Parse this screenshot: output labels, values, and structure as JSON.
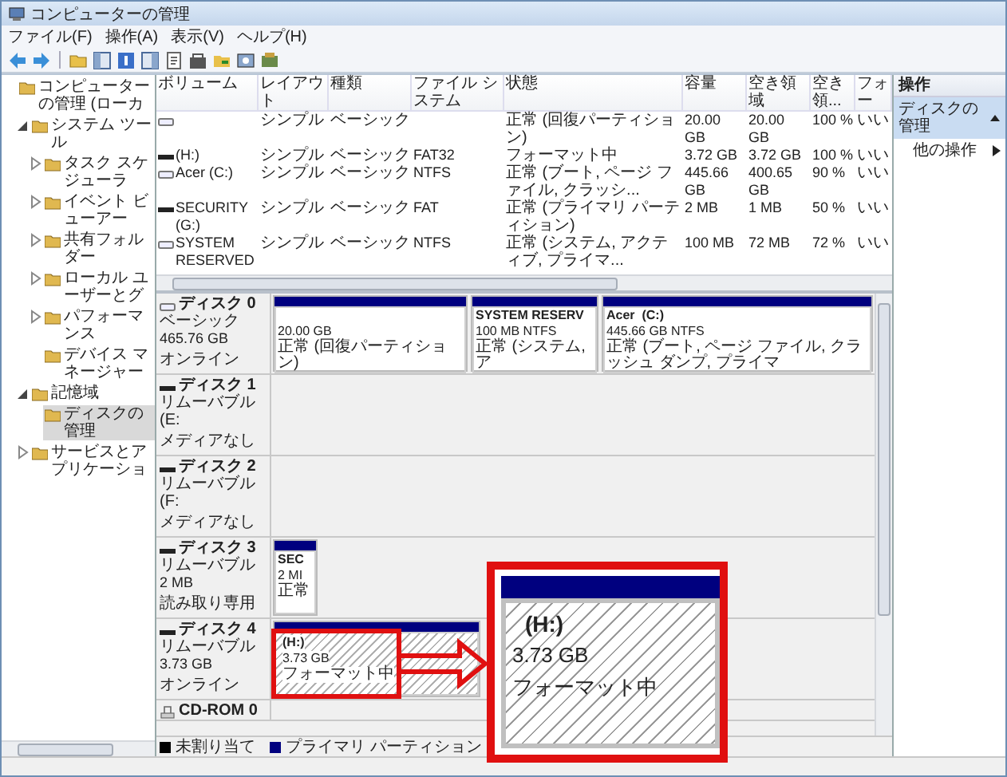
{
  "window": {
    "title": "コンピューターの管理"
  },
  "menu": [
    "ファイル(F)",
    "操作(A)",
    "表示(V)",
    "ヘルプ(H)"
  ],
  "tree": [
    {
      "label": "コンピューターの管理 (ローカ",
      "selected": false,
      "children": [
        {
          "label": "システム ツール",
          "expanded": true,
          "selected": false,
          "children": [
            {
              "label": "タスク スケジューラ",
              "expanded": false,
              "selected": false
            },
            {
              "label": "イベント ビューアー",
              "expanded": false,
              "selected": false
            },
            {
              "label": "共有フォルダー",
              "expanded": false,
              "selected": false
            },
            {
              "label": "ローカル ユーザーとグ",
              "expanded": false,
              "selected": false
            },
            {
              "label": "パフォーマンス",
              "expanded": false,
              "selected": false
            },
            {
              "label": "デバイス マネージャー",
              "selected": false
            }
          ]
        },
        {
          "label": "記憶域",
          "expanded": true,
          "selected": false,
          "children": [
            {
              "label": "ディスクの管理",
              "selected": true
            }
          ]
        },
        {
          "label": "サービスとアプリケーショ",
          "expanded": false,
          "selected": false
        }
      ]
    }
  ],
  "volumes": {
    "columns": [
      "ボリューム",
      "レイアウト",
      "種類",
      "ファイル システム",
      "状態",
      "容量",
      "空き領域",
      "空き領...",
      "フォー"
    ],
    "rows": [
      {
        "kind": "fixed",
        "layout": "シンプル",
        "type": "ベーシック",
        "status": "正常 (回復パーティション)",
        "capacity": "20.00 GB",
        "free_space": "20.00 GB",
        "percent_free": "100 %",
        "column_9": "いい"
      },
      {
        "kind": "removable",
        "volume": "(H:)",
        "layout": "シンプル",
        "type": "ベーシック",
        "file_system": "FAT32",
        "status": "フォーマット中",
        "capacity": "3.72 GB",
        "free_space": "3.72 GB",
        "percent_free": "100 %",
        "column_9": "いい"
      },
      {
        "kind": "fixed",
        "volume": "Acer (C:)",
        "layout": "シンプル",
        "type": "ベーシック",
        "file_system": "NTFS",
        "status": "正常 (ブート, ページ ファイル, クラッシ...",
        "capacity": "445.66 GB",
        "free_space": "400.65 GB",
        "percent_free": "90 %",
        "column_9": "いい"
      },
      {
        "kind": "removable",
        "volume": "SECURITY (G:)",
        "layout": "シンプル",
        "type": "ベーシック",
        "file_system": "FAT",
        "status": "正常 (プライマリ パーティション)",
        "capacity": "2 MB",
        "free_space": "1 MB",
        "percent_free": "50 %",
        "column_9": "いい"
      },
      {
        "kind": "fixed",
        "volume": "SYSTEM RESERVED",
        "layout": "シンプル",
        "type": "ベーシック",
        "file_system": "NTFS",
        "status": "正常 (システム, アクティブ, プライマ...",
        "capacity": "100 MB",
        "free_space": "72 MB",
        "percent_free": "72 %",
        "column_9": "いい"
      }
    ]
  },
  "disks": [
    {
      "kind": "basic",
      "name": "ディスク 0",
      "type": "ベーシック",
      "size": "465.76 GB",
      "status": "オンライン",
      "partitions": [
        {
          "kind": "primary",
          "size": "20.00 GB",
          "status": "正常 (回復パーティション)"
        },
        {
          "kind": "primary",
          "name": "SYSTEM RESERV",
          "size": "100 MB NTFS",
          "status": "正常 (システム, ア"
        },
        {
          "kind": "primary",
          "name": "Acer  (C:)",
          "size": "445.66 GB NTFS",
          "status": "正常 (ブート, ページ ファイル, クラッシュ ダンプ, プライマ"
        }
      ]
    },
    {
      "kind": "removable",
      "name": "ディスク 1",
      "type": "リムーバブル (E:",
      "status": "メディアなし"
    },
    {
      "kind": "removable",
      "name": "ディスク 2",
      "type": "リムーバブル (F:",
      "status": "メディアなし"
    },
    {
      "kind": "removable",
      "name": "ディスク 3",
      "type": "リムーバブル",
      "size": "2 MB",
      "status": "読み取り専用",
      "partitions": [
        {
          "kind": "primary",
          "name": "SEC",
          "size": "2 MI",
          "status": "正常"
        }
      ]
    },
    {
      "kind": "removable",
      "name": "ディスク 4",
      "type": "リムーバブル",
      "size": "3.73 GB",
      "status": "オンライン",
      "partitions": [
        {
          "kind": "formatting",
          "name": "(H:)",
          "size": "3.73 GB",
          "status": "フォーマット中"
        }
      ]
    },
    {
      "kind": "cdrom",
      "name": "CD-ROM 0"
    }
  ],
  "legend": [
    {
      "label": "未割り当て",
      "color": "#000000"
    },
    {
      "label": "プライマリ パーティション",
      "color": "#00007f"
    }
  ],
  "actions": {
    "title": "操作",
    "section": {
      "label": "ディスクの管理",
      "expanded": true
    },
    "items": [
      "他の操作"
    ]
  },
  "callout": {
    "name": "(H:)",
    "size": "3.73 GB",
    "status": "フォーマット中"
  }
}
